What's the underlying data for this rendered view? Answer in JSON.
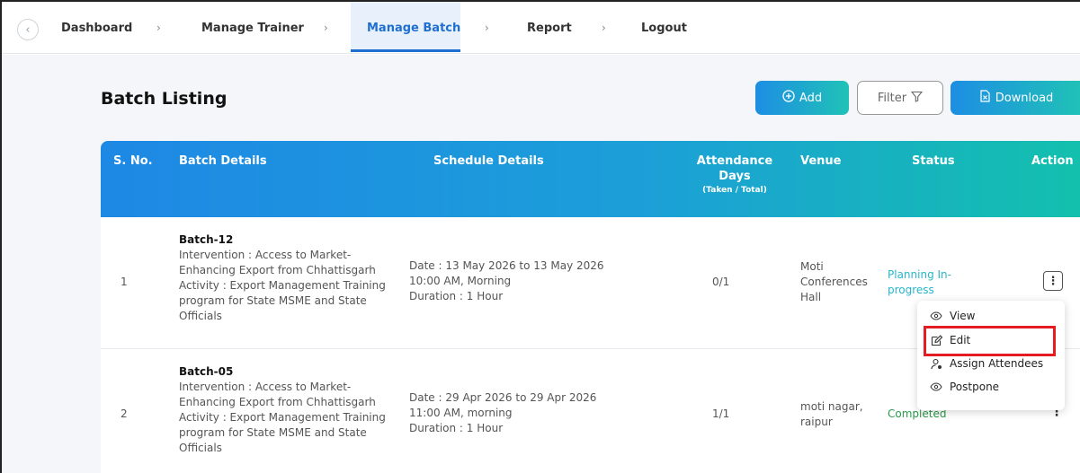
{
  "nav": {
    "items": [
      {
        "label": "Dashboard"
      },
      {
        "label": "Manage Trainer"
      },
      {
        "label": "Manage Batch"
      },
      {
        "label": "Report"
      },
      {
        "label": "Logout"
      }
    ],
    "separator": "›"
  },
  "page": {
    "title": "Batch Listing",
    "add_label": "Add",
    "filter_label": "Filter",
    "download_label": "Download"
  },
  "table": {
    "headers": {
      "sno": "S. No.",
      "batch": "Batch Details",
      "schedule": "Schedule Details",
      "attendance_1": "Attendance",
      "attendance_2": "Days",
      "attendance_3": "(Taken / Total)",
      "venue": "Venue",
      "status": "Status",
      "action": "Action"
    },
    "rows": [
      {
        "sno": "1",
        "batch_name": "Batch-12",
        "detail_1": "Intervention : Access to Market-",
        "detail_2": "Enhancing Export from Chhattisgarh",
        "detail_3": "Activity : Export Management Training",
        "detail_4": "program for State MSME and State",
        "detail_5": "Officials",
        "date": "Date : 13 May 2026 to 13 May 2026",
        "time": "10:00 AM, Morning",
        "duration": "Duration : 1 Hour",
        "attendance": "0/1",
        "venue_1": "Moti",
        "venue_2": "Conferences",
        "venue_3": "Hall",
        "status_1": "Planning In-",
        "status_2": "progress"
      },
      {
        "sno": "2",
        "batch_name": "Batch-05",
        "detail_1": "Intervention : Access to Market-",
        "detail_2": "Enhancing Export from Chhattisgarh",
        "detail_3": "Activity : Export Management Training",
        "detail_4": "program for State MSME and State",
        "detail_5": "Officials",
        "date": "Date : 29 Apr 2026 to 29 Apr 2026",
        "time": "11:00 AM, morning",
        "duration": "Duration : 1 Hour",
        "attendance": "1/1",
        "venue_1": "moti nagar,",
        "venue_2": "raipur",
        "status_1": "Completed"
      }
    ]
  },
  "action_menu": {
    "view": "View",
    "edit": "Edit",
    "assign": "Assign Attendees",
    "postpone": "Postpone"
  },
  "kebab_glyph": "⋮",
  "colors": {
    "accent": "#1f6fd1",
    "gradient_start": "#1e88e5",
    "gradient_end": "#13c0ad",
    "planning": "#27b6c9",
    "completed": "#2a9a4a",
    "highlight": "#e41d25"
  }
}
